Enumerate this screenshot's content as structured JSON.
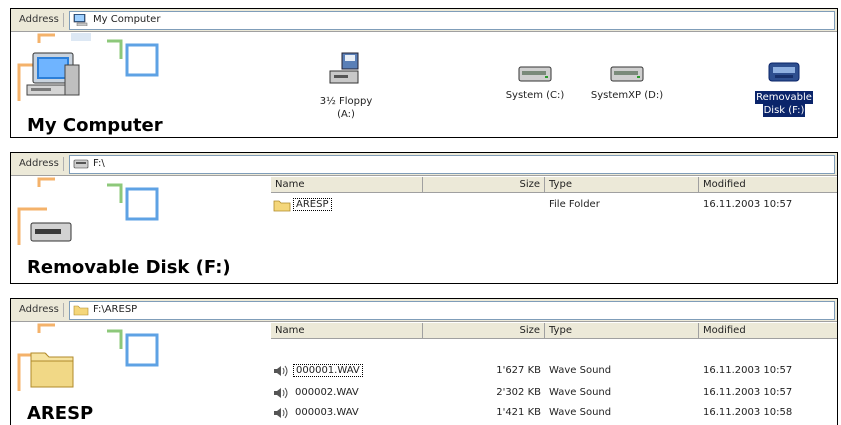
{
  "panels": [
    {
      "address_label": "Address",
      "address_value": "My Computer",
      "title": "My Computer",
      "drives": [
        {
          "label_line1": "3½ Floppy",
          "label_line2": "(A:)",
          "icon": "floppy-drive-icon"
        },
        {
          "label_line1": "System (C:)",
          "label_line2": "",
          "icon": "hard-drive-icon"
        },
        {
          "label_line1": "SystemXP (D:)",
          "label_line2": "",
          "icon": "hard-drive-icon"
        },
        {
          "label_line1": "Removable",
          "label_line2": "Disk (F:)",
          "icon": "removable-disk-icon",
          "selected": true
        }
      ]
    },
    {
      "address_label": "Address",
      "address_value": "F:\\",
      "title": "Removable Disk (F:)",
      "columns": {
        "name": "Name",
        "size": "Size",
        "type": "Type",
        "modified": "Modified"
      },
      "rows": [
        {
          "name": "ARESP",
          "size": "",
          "type": "File Folder",
          "modified": "16.11.2003 10:57",
          "icon": "folder-icon"
        }
      ]
    },
    {
      "address_label": "Address",
      "address_value": "F:\\ARESP",
      "title": "ARESP",
      "columns": {
        "name": "Name",
        "size": "Size",
        "type": "Type",
        "modified": "Modified"
      },
      "rows": [
        {
          "name": "000001.WAV",
          "size": "1'627 KB",
          "type": "Wave Sound",
          "modified": "16.11.2003 10:57",
          "icon": "wave-sound-icon"
        },
        {
          "name": "000002.WAV",
          "size": "2'302 KB",
          "type": "Wave Sound",
          "modified": "16.11.2003 10:57",
          "icon": "wave-sound-icon"
        },
        {
          "name": "000003.WAV",
          "size": "1'421 KB",
          "type": "Wave Sound",
          "modified": "16.11.2003 10:58",
          "icon": "wave-sound-icon"
        }
      ]
    }
  ]
}
